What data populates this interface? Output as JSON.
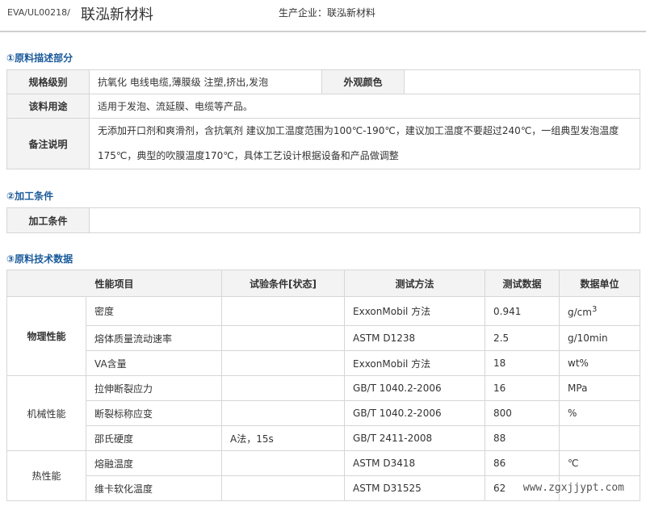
{
  "header": {
    "code": "EVA/UL00218/",
    "title": "联泓新材料",
    "producer": "生产企业：联泓新材料"
  },
  "sections": {
    "desc_title": "①原料描述部分",
    "cond_title": "②加工条件",
    "tech_title": "③原料技术数据"
  },
  "description": {
    "spec_label": "规格级别",
    "spec_value": "抗氧化 电线电缆,薄膜级 注塑,挤出,发泡",
    "color_label": "外观颜色",
    "color_value": "",
    "use_label": "该料用途",
    "use_value": "适用于发泡、流延膜、电缆等产品。",
    "note_label": "备注说明",
    "note_line1": "无添加开口剂和爽滑剂，含抗氧剂 建议加工温度范围为100℃-190℃，建议加工温度不要超过240℃，一组典型发泡温度",
    "note_line2": "175℃，典型的吹膜温度170℃，具体工艺设计根据设备和产品做调整"
  },
  "conditions": {
    "label": "加工条件",
    "value": ""
  },
  "tech": {
    "headers": [
      "性能项目",
      "试验条件[状态]",
      "测试方法",
      "测试数据",
      "数据单位"
    ],
    "groups": [
      {
        "category": "物理性能",
        "rows": [
          {
            "item": "密度",
            "condition": "",
            "method": "ExxonMobil 方法",
            "value": "0.941",
            "unit": "g/cm",
            "unit_sup": "3"
          },
          {
            "item": "熔体质量流动速率",
            "condition": "",
            "method": "ASTM D1238",
            "value": "2.5",
            "unit": "g/10min",
            "unit_sup": ""
          },
          {
            "item": "VA含量",
            "condition": "",
            "method": "ExxonMobil 方法",
            "value": "18",
            "unit": "wt%",
            "unit_sup": ""
          }
        ]
      },
      {
        "category": "机械性能",
        "rows": [
          {
            "item": "拉伸断裂应力",
            "condition": "",
            "method": "GB/T 1040.2-2006",
            "value": "16",
            "unit": "MPa",
            "unit_sup": ""
          },
          {
            "item": "断裂标称应变",
            "condition": "",
            "method": "GB/T 1040.2-2006",
            "value": "800",
            "unit": "%",
            "unit_sup": ""
          },
          {
            "item": "邵氏硬度",
            "condition": "A法，15s",
            "method": "GB/T 2411-2008",
            "value": "88",
            "unit": "",
            "unit_sup": ""
          }
        ]
      },
      {
        "category": "热性能",
        "rows": [
          {
            "item": "熔融温度",
            "condition": "",
            "method": "ASTM D3418",
            "value": "86",
            "unit": "℃",
            "unit_sup": ""
          },
          {
            "item": "维卡软化温度",
            "condition": "",
            "method": "ASTM D31525",
            "value": "62",
            "unit": "",
            "unit_sup": ""
          }
        ]
      }
    ]
  },
  "watermark": "www.zgxjjypt.com"
}
